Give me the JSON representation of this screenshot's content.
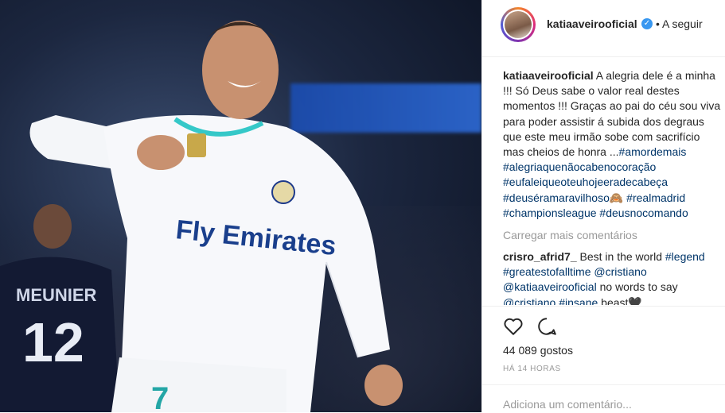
{
  "post": {
    "username": "katiaaveirooficial",
    "follow_label": "• A seguir",
    "caption_lines": [
      {
        "user": "katiaaveirooficial",
        "text": " A alegria dele é a minha"
      },
      {
        "text": "!!! Só Deus sabe o valor real destes"
      },
      {
        "text": "momentos !!! Graças ao pai do céu sou viva"
      },
      {
        "text": "para poder assistir á subida dos degraus"
      },
      {
        "text": "que este meu irmão sobe com sacrifício"
      },
      {
        "text": "mas cheios de honra ...",
        "tag": "#amordemais"
      },
      {
        "tag": "#alegriaquenãocabenocoração"
      },
      {
        "tag": "#eufaleiqueoteuhojeeradecabeça"
      },
      {
        "tag": "#deuséramaravilhoso🙈",
        "tag2": " #realmadrid"
      },
      {
        "tag": "#championsleague",
        "tag2": " #deusnocomando"
      }
    ],
    "load_more": "Carregar mais comentários",
    "reply_lines": [
      {
        "user": "crisro_afrid7_",
        "text": " Best in the world ",
        "tag": "#legend"
      },
      {
        "tag": "#greatestofalltime",
        "tag2": " @cristiano"
      },
      {
        "tag": "@katiaaveirooficial",
        "text": " no words to say"
      },
      {
        "tag": "@cristiano",
        "tag2": " #insane",
        "text": " beast🖤"
      }
    ],
    "likes": "44 089 gostos",
    "time": "HÁ 14 HORAS",
    "add_comment_placeholder": "Adiciona um comentário..."
  },
  "photo": {
    "jersey_sponsor": "Fly Emirates",
    "jersey_number": "7",
    "bg_player_name": "MEUNIER",
    "bg_player_number": "12"
  },
  "colors": {
    "accent": "#3897f0",
    "tag": "#003569",
    "muted": "#999999"
  },
  "icons": [
    "verified-badge-icon",
    "heart-icon",
    "comment-icon"
  ]
}
